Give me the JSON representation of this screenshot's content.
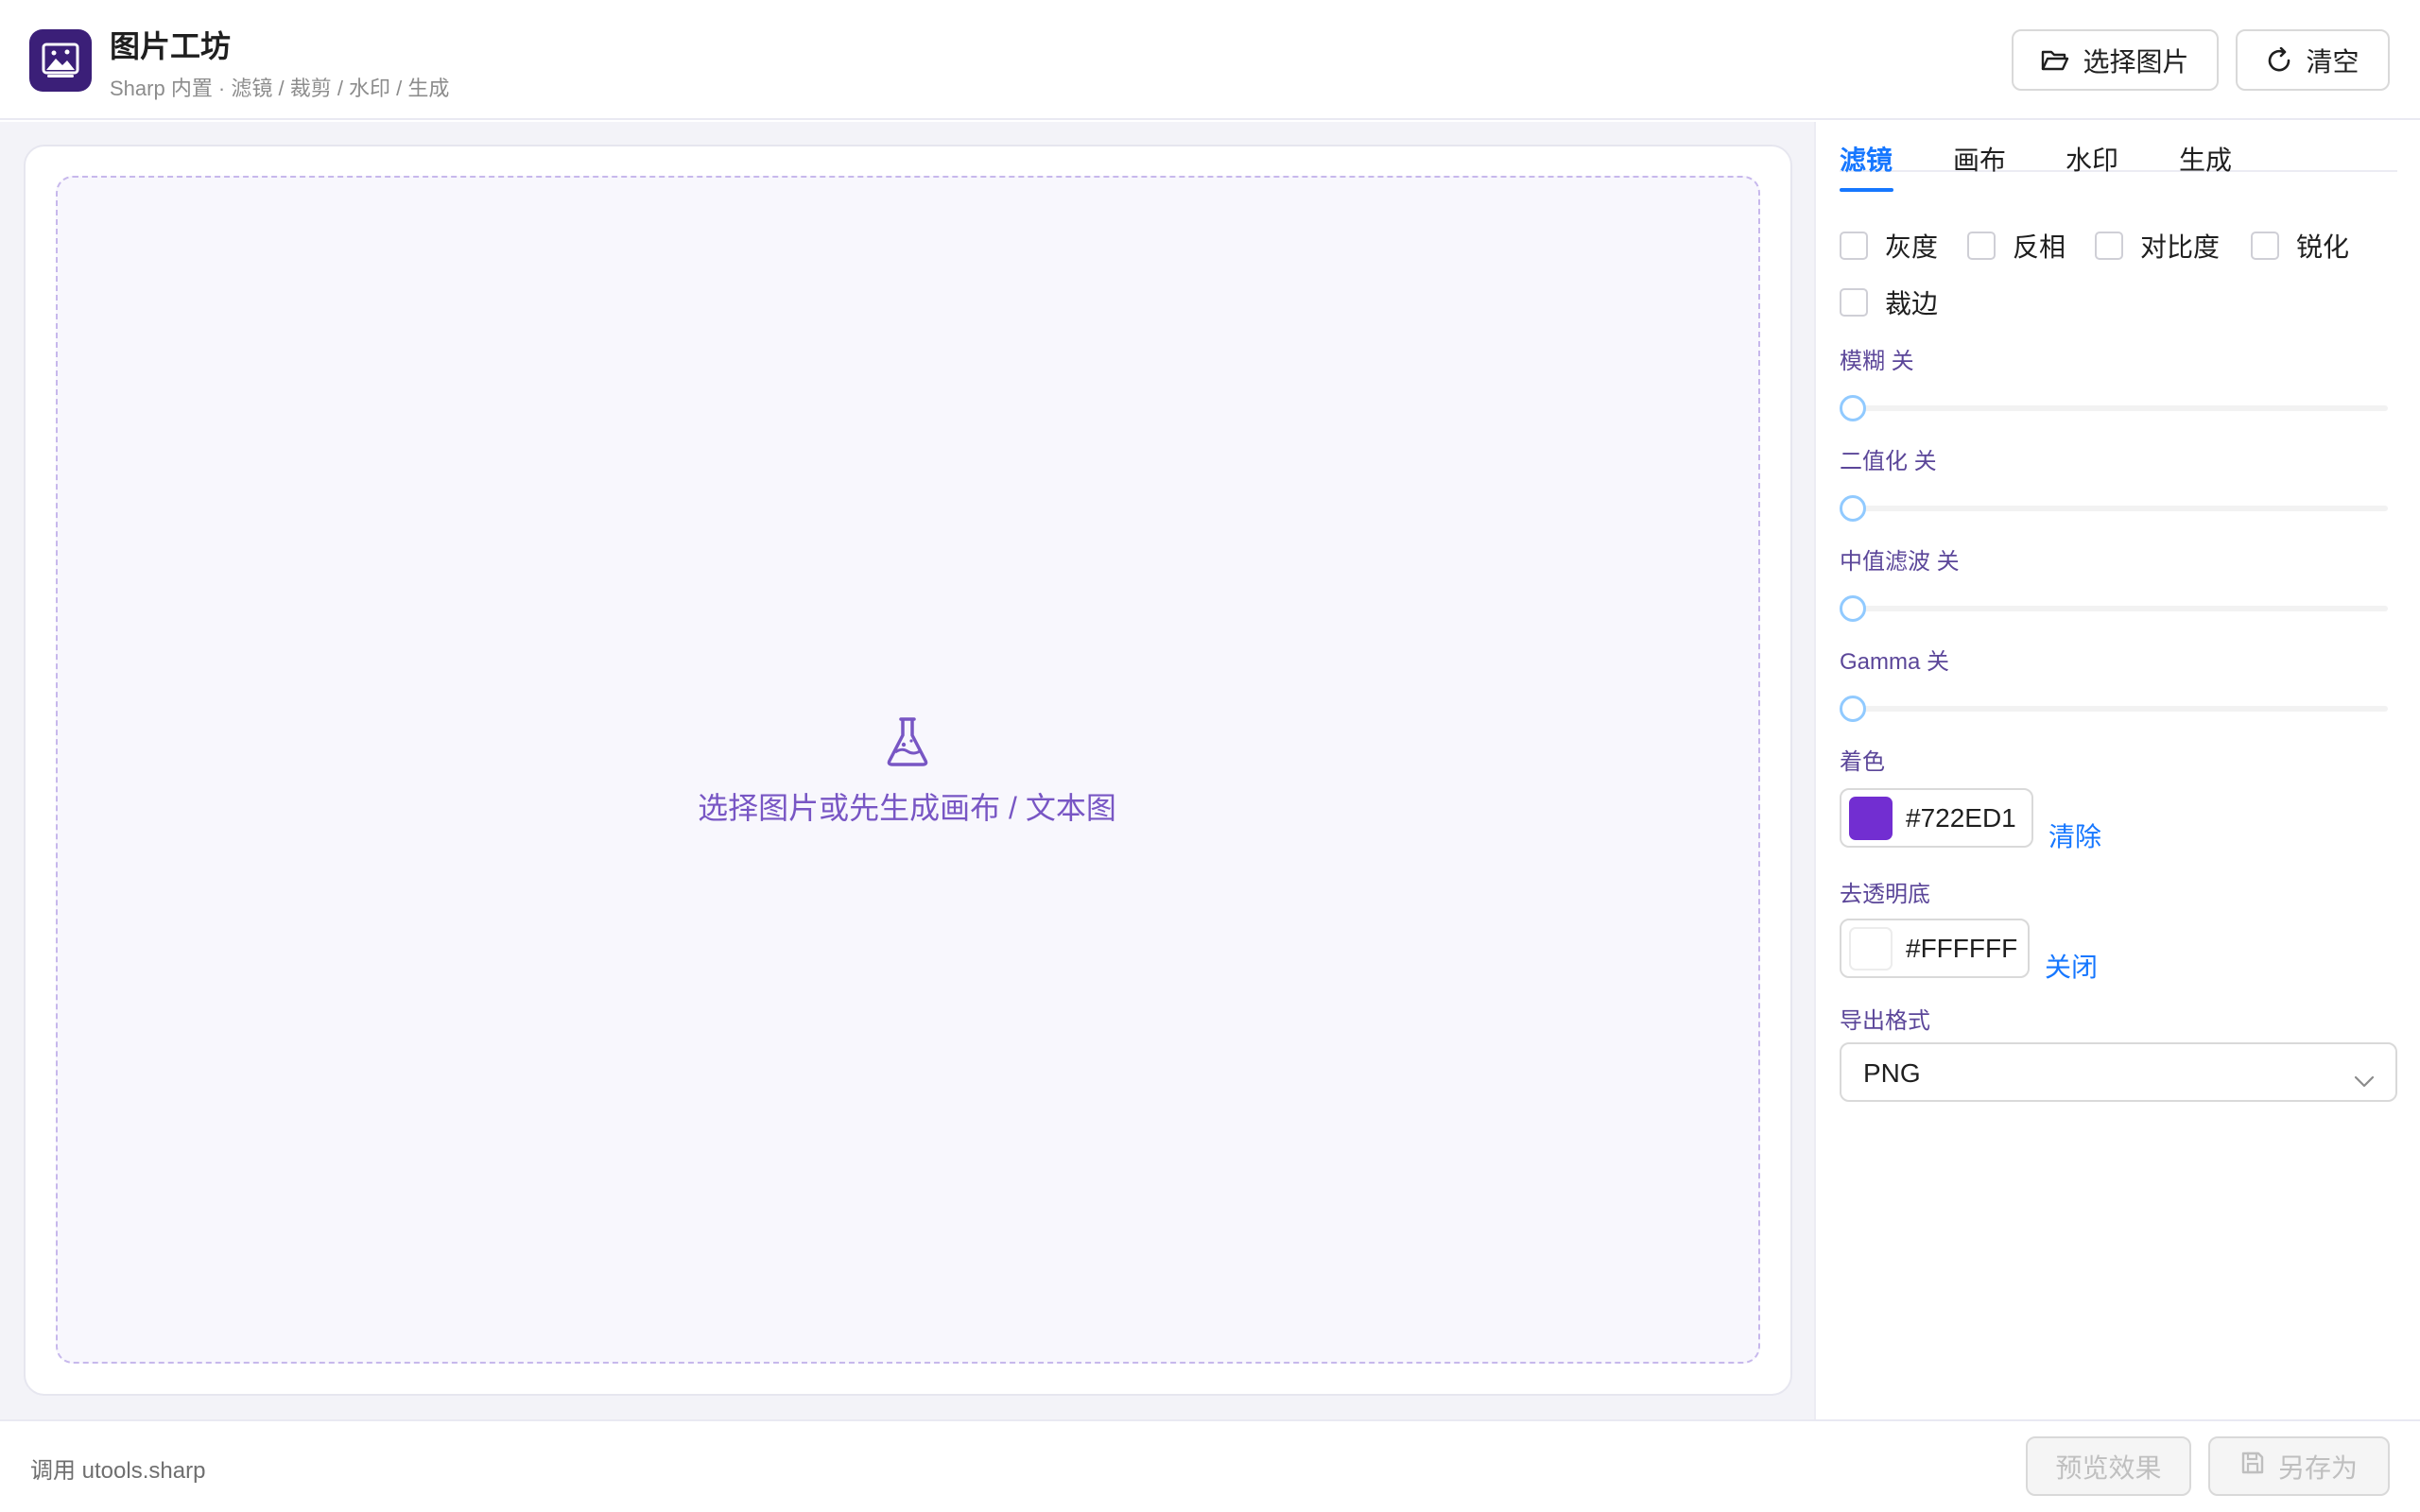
{
  "header": {
    "title": "图片工坊",
    "subtitle": "Sharp 内置 · 滤镜 / 裁剪 / 水印 / 生成",
    "pick_button": "选择图片",
    "clear_button": "清空"
  },
  "workspace": {
    "placeholder": "选择图片或先生成画布 / 文本图"
  },
  "panel": {
    "tabs": [
      {
        "label": "滤镜",
        "active": true
      },
      {
        "label": "画布",
        "active": false
      },
      {
        "label": "水印",
        "active": false
      },
      {
        "label": "生成",
        "active": false
      }
    ],
    "checkboxes": [
      {
        "label": "灰度",
        "checked": false
      },
      {
        "label": "反相",
        "checked": false
      },
      {
        "label": "对比度",
        "checked": false
      },
      {
        "label": "锐化",
        "checked": false
      },
      {
        "label": "裁边",
        "checked": false
      }
    ],
    "sliders": [
      {
        "label": "模糊 关",
        "value": 0
      },
      {
        "label": "二值化 关",
        "value": 0
      },
      {
        "label": "中值滤波 关",
        "value": 0
      },
      {
        "label": "Gamma 关",
        "value": 0
      }
    ],
    "tint": {
      "label": "着色",
      "color": "#722ED1",
      "action": "清除"
    },
    "flatten": {
      "label": "去透明底",
      "color": "#FFFFFF",
      "action": "关闭"
    },
    "format": {
      "label": "导出格式",
      "value": "PNG"
    }
  },
  "footer": {
    "status": "调用 utools.sharp",
    "preview_button": "预览效果",
    "save_button": "另存为"
  },
  "colors": {
    "accent": "#1677ff",
    "brand": "#3b1f78",
    "placeholder_text": "#7856c4",
    "label_text": "#5b4699"
  }
}
